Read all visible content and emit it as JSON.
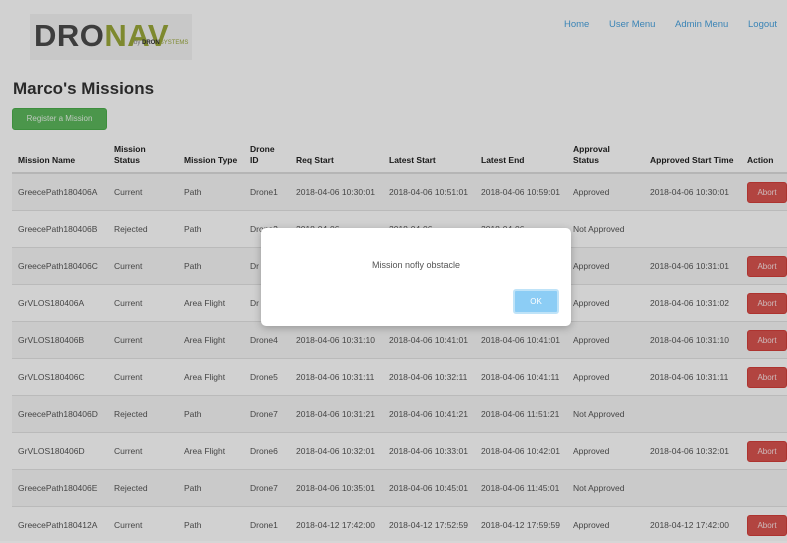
{
  "header": {
    "logo_dro": "DRO",
    "logo_nav": "NAV",
    "logo_by": "by",
    "logo_sub_a": "DRON",
    "logo_sub_b": "SYSTEMS",
    "nav": [
      {
        "label": "Home"
      },
      {
        "label": "User Menu"
      },
      {
        "label": "Admin Menu"
      },
      {
        "label": "Logout"
      }
    ]
  },
  "page": {
    "title": "Marco's Missions",
    "register_label": "Register a Mission"
  },
  "table": {
    "headers": [
      "Mission Name",
      "Mission Status",
      "Mission Type",
      "Drone ID",
      "Req Start",
      "Latest Start",
      "Latest End",
      "Approval Status",
      "Approved Start Time",
      "Action"
    ],
    "rows": [
      {
        "name": "GreecePath180406A",
        "status": "Current",
        "type": "Path",
        "drone": "Drone1",
        "req": "2018-04-06 10:30:01",
        "lstart": "2018-04-06 10:51:01",
        "lend": "2018-04-06 10:59:01",
        "approval": "Approved",
        "approved_time": "2018-04-06 10:30:01",
        "action": "Abort"
      },
      {
        "name": "GreecePath180406B",
        "status": "Rejected",
        "type": "Path",
        "drone": "Drone2",
        "req": "2018-04-06",
        "lstart": "2018-04-06",
        "lend": "2018-04-06",
        "approval": "Not Approved",
        "approved_time": "",
        "action": ""
      },
      {
        "name": "GreecePath180406C",
        "status": "Current",
        "type": "Path",
        "drone": "Dr",
        "req": "",
        "lstart": "",
        "lend": "",
        "approval": "Approved",
        "approved_time": "2018-04-06 10:31:01",
        "action": "Abort"
      },
      {
        "name": "GrVLOS180406A",
        "status": "Current",
        "type": "Area Flight",
        "drone": "Dr",
        "req": "",
        "lstart": "",
        "lend": "",
        "approval": "Approved",
        "approved_time": "2018-04-06 10:31:02",
        "action": "Abort"
      },
      {
        "name": "GrVLOS180406B",
        "status": "Current",
        "type": "Area Flight",
        "drone": "Drone4",
        "req": "2018-04-06 10:31:10",
        "lstart": "2018-04-06 10:41:01",
        "lend": "2018-04-06 10:41:01",
        "approval": "Approved",
        "approved_time": "2018-04-06 10:31:10",
        "action": "Abort"
      },
      {
        "name": "GrVLOS180406C",
        "status": "Current",
        "type": "Area Flight",
        "drone": "Drone5",
        "req": "2018-04-06 10:31:11",
        "lstart": "2018-04-06 10:32:11",
        "lend": "2018-04-06 10:41:11",
        "approval": "Approved",
        "approved_time": "2018-04-06 10:31:11",
        "action": "Abort"
      },
      {
        "name": "GreecePath180406D",
        "status": "Rejected",
        "type": "Path",
        "drone": "Drone7",
        "req": "2018-04-06 10:31:21",
        "lstart": "2018-04-06 10:41:21",
        "lend": "2018-04-06 11:51:21",
        "approval": "Not Approved",
        "approved_time": "",
        "action": ""
      },
      {
        "name": "GrVLOS180406D",
        "status": "Current",
        "type": "Area Flight",
        "drone": "Drone6",
        "req": "2018-04-06 10:32:01",
        "lstart": "2018-04-06 10:33:01",
        "lend": "2018-04-06 10:42:01",
        "approval": "Approved",
        "approved_time": "2018-04-06 10:32:01",
        "action": "Abort"
      },
      {
        "name": "GreecePath180406E",
        "status": "Rejected",
        "type": "Path",
        "drone": "Drone7",
        "req": "2018-04-06 10:35:01",
        "lstart": "2018-04-06 10:45:01",
        "lend": "2018-04-06 11:45:01",
        "approval": "Not Approved",
        "approved_time": "",
        "action": ""
      },
      {
        "name": "GreecePath180412A",
        "status": "Current",
        "type": "Path",
        "drone": "Drone1",
        "req": "2018-04-12 17:42:00",
        "lstart": "2018-04-12 17:52:59",
        "lend": "2018-04-12 17:59:59",
        "approval": "Approved",
        "approved_time": "2018-04-12 17:42:00",
        "action": "Abort"
      }
    ]
  },
  "modal": {
    "message": "Mission nofly obstacle",
    "ok_label": "OK"
  }
}
